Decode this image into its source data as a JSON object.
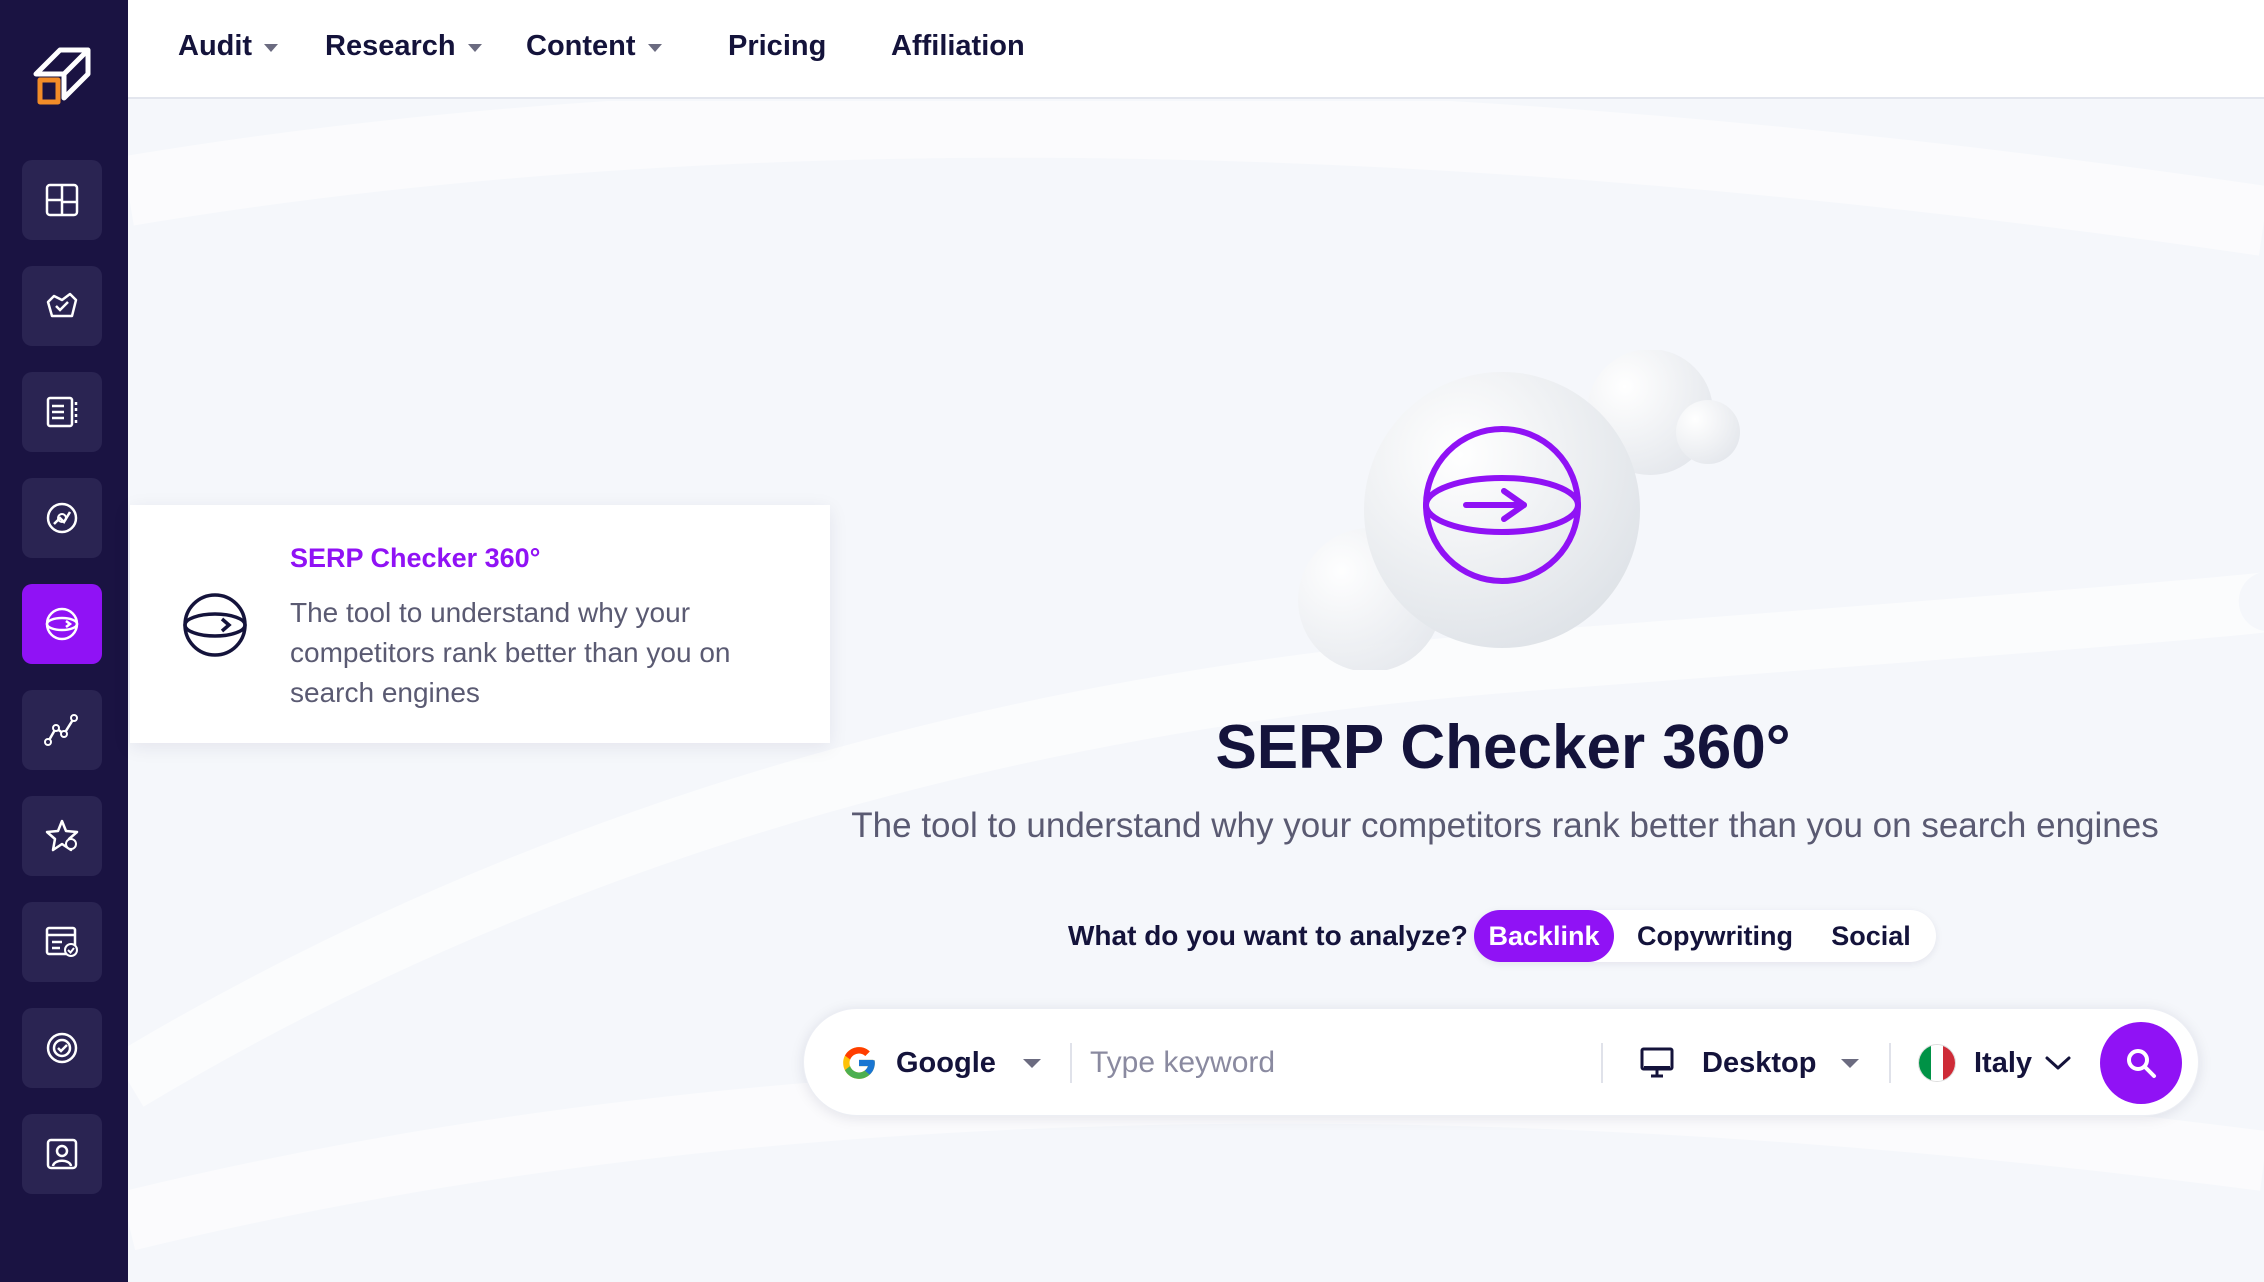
{
  "colors": {
    "sidebar_bg": "#1a1342",
    "sidebar_button_bg": "#2a2452",
    "accent": "#9012f5",
    "text_dark": "#14133b",
    "text_muted": "#5a5a72",
    "logo_orange": "#f28c28"
  },
  "sidebar": {
    "items": [
      {
        "icon": "dashboard-grid-icon",
        "active": false
      },
      {
        "icon": "audit-checkup-icon",
        "active": false
      },
      {
        "icon": "site-structure-icon",
        "active": false
      },
      {
        "icon": "domain-analysis-icon",
        "active": false
      },
      {
        "icon": "serp-checker-icon",
        "active": true
      },
      {
        "icon": "rank-tracker-icon",
        "active": false
      },
      {
        "icon": "favorites-star-icon",
        "active": false
      },
      {
        "icon": "report-check-icon",
        "active": false
      },
      {
        "icon": "target-check-icon",
        "active": false
      },
      {
        "icon": "user-profile-icon",
        "active": false
      }
    ]
  },
  "nav": {
    "audit": "Audit",
    "research": "Research",
    "content": "Content",
    "pricing": "Pricing",
    "affiliation": "Affiliation"
  },
  "tooltip": {
    "title": "SERP Checker 360°",
    "description": "The tool to understand why your competitors rank better than you on search engines"
  },
  "hero": {
    "title": "SERP Checker 360°",
    "subtitle": "The tool to understand why your competitors rank better than you on search engines"
  },
  "analyze": {
    "label": "What do you want to analyze?",
    "options": [
      "Backlink",
      "Copywriting",
      "Social"
    ],
    "selected": "Backlink"
  },
  "search": {
    "engine": "Google",
    "keyword_placeholder": "Type keyword",
    "keyword_value": "",
    "device": "Desktop",
    "country": "Italy"
  }
}
